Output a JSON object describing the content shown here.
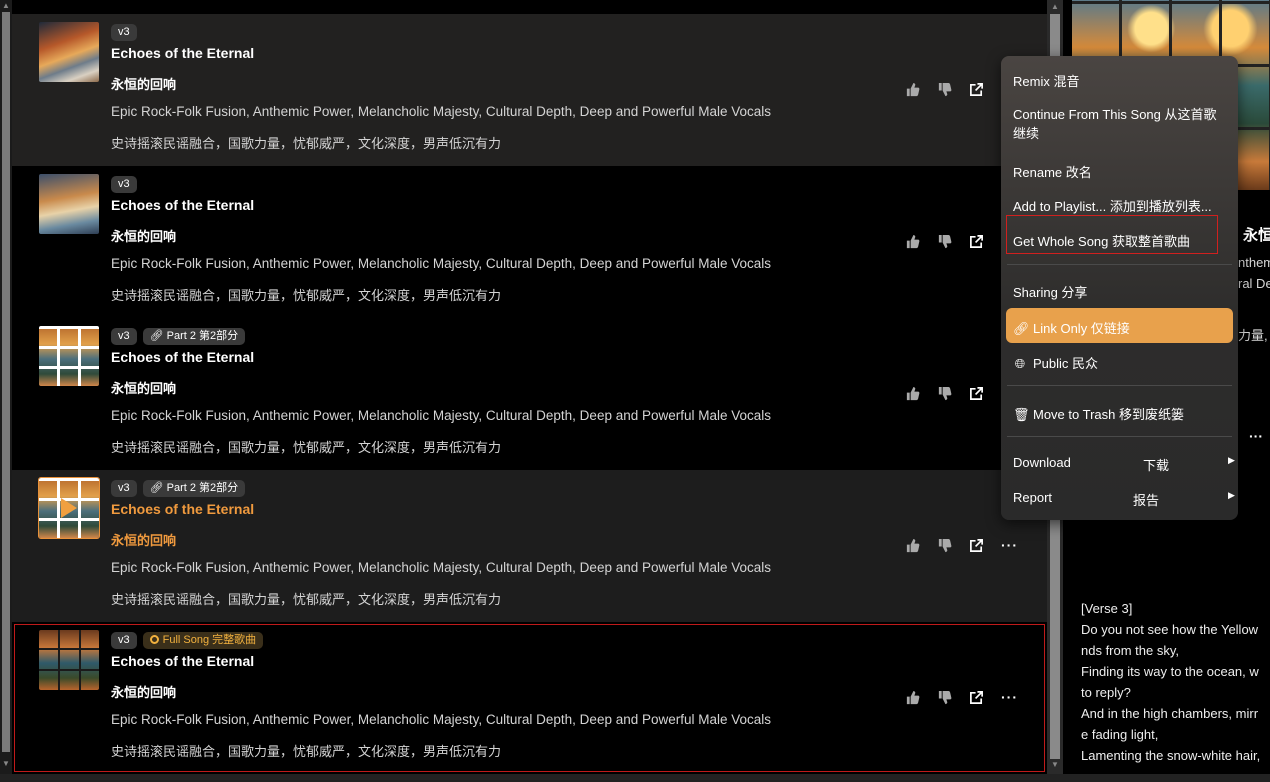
{
  "songs": [
    {
      "badges": [
        "v3"
      ],
      "title": "Echoes of the Eternal",
      "subtitle": "永恒的回响",
      "tags": "Epic Rock-Folk Fusion, Anthemic Power, Melancholic Majesty, Cultural Depth, Deep and Powerful Male Vocals",
      "tags_zh": "史诗摇滚民谣融合，国歌力量，忧郁威严，文化深度，男声低沉有力"
    },
    {
      "badges": [
        "v3"
      ],
      "title": "Echoes of the Eternal",
      "subtitle": "永恒的回响",
      "tags": "Epic Rock-Folk Fusion, Anthemic Power, Melancholic Majesty, Cultural Depth, Deep and Powerful Male Vocals",
      "tags_zh": "史诗摇滚民谣融合，国歌力量，忧郁威严，文化深度，男声低沉有力"
    },
    {
      "badges": [
        "v3",
        "Part 2 第2部分"
      ],
      "title": "Echoes of the Eternal",
      "subtitle": "永恒的回响",
      "tags": "Epic Rock-Folk Fusion, Anthemic Power, Melancholic Majesty, Cultural Depth, Deep and Powerful Male Vocals",
      "tags_zh": "史诗摇滚民谣融合，国歌力量，忧郁威严，文化深度，男声低沉有力"
    },
    {
      "badges": [
        "v3",
        "Part 2 第2部分"
      ],
      "title": "Echoes of the Eternal",
      "subtitle": "永恒的回响",
      "tags": "Epic Rock-Folk Fusion, Anthemic Power, Melancholic Majesty, Cultural Depth, Deep and Powerful Male Vocals",
      "tags_zh": "史诗摇滚民谣融合，国歌力量，忧郁威严，文化深度，男声低沉有力"
    },
    {
      "badges": [
        "v3",
        "Full Song 完整歌曲"
      ],
      "title": "Echoes of the Eternal",
      "subtitle": "永恒的回响",
      "tags": "Epic Rock-Folk Fusion, Anthemic Power, Melancholic Majesty, Cultural Depth, Deep and Powerful Male Vocals",
      "tags_zh": "史诗摇滚民谣融合，国歌力量，忧郁威严，文化深度，男声低沉有力"
    }
  ],
  "menu": {
    "remix": "Remix 混音",
    "continue": "Continue From This Song 从这首歌继续",
    "rename": "Rename 改名",
    "add_playlist": "Add to Playlist... 添加到播放列表...",
    "get_whole": "Get Whole Song 获取整首歌曲",
    "sharing": "Sharing 分享",
    "link_only": "Link Only 仅链接",
    "public": "Public 民众",
    "trash": "Move to Trash 移到废纸篓",
    "download": "Download",
    "download_zh": "下载",
    "report": "Report",
    "report_zh": "报告"
  },
  "right_pane": {
    "title_frag": "永恒",
    "frag1": "nthem",
    "frag2": "ral De",
    "frag3": "力量,",
    "lyrics": [
      "[Verse 3]",
      "Do you not see how the Yellow",
      "nds from the sky,",
      "Finding its way to the ocean, w",
      "to reply?",
      "And in the high chambers, mirr",
      "e fading light,",
      "Lamenting the snow-white hair,"
    ]
  },
  "colors": {
    "accent": "#e8a14c",
    "active_text": "#f09a3e",
    "selection_red": "#c01a1a"
  }
}
